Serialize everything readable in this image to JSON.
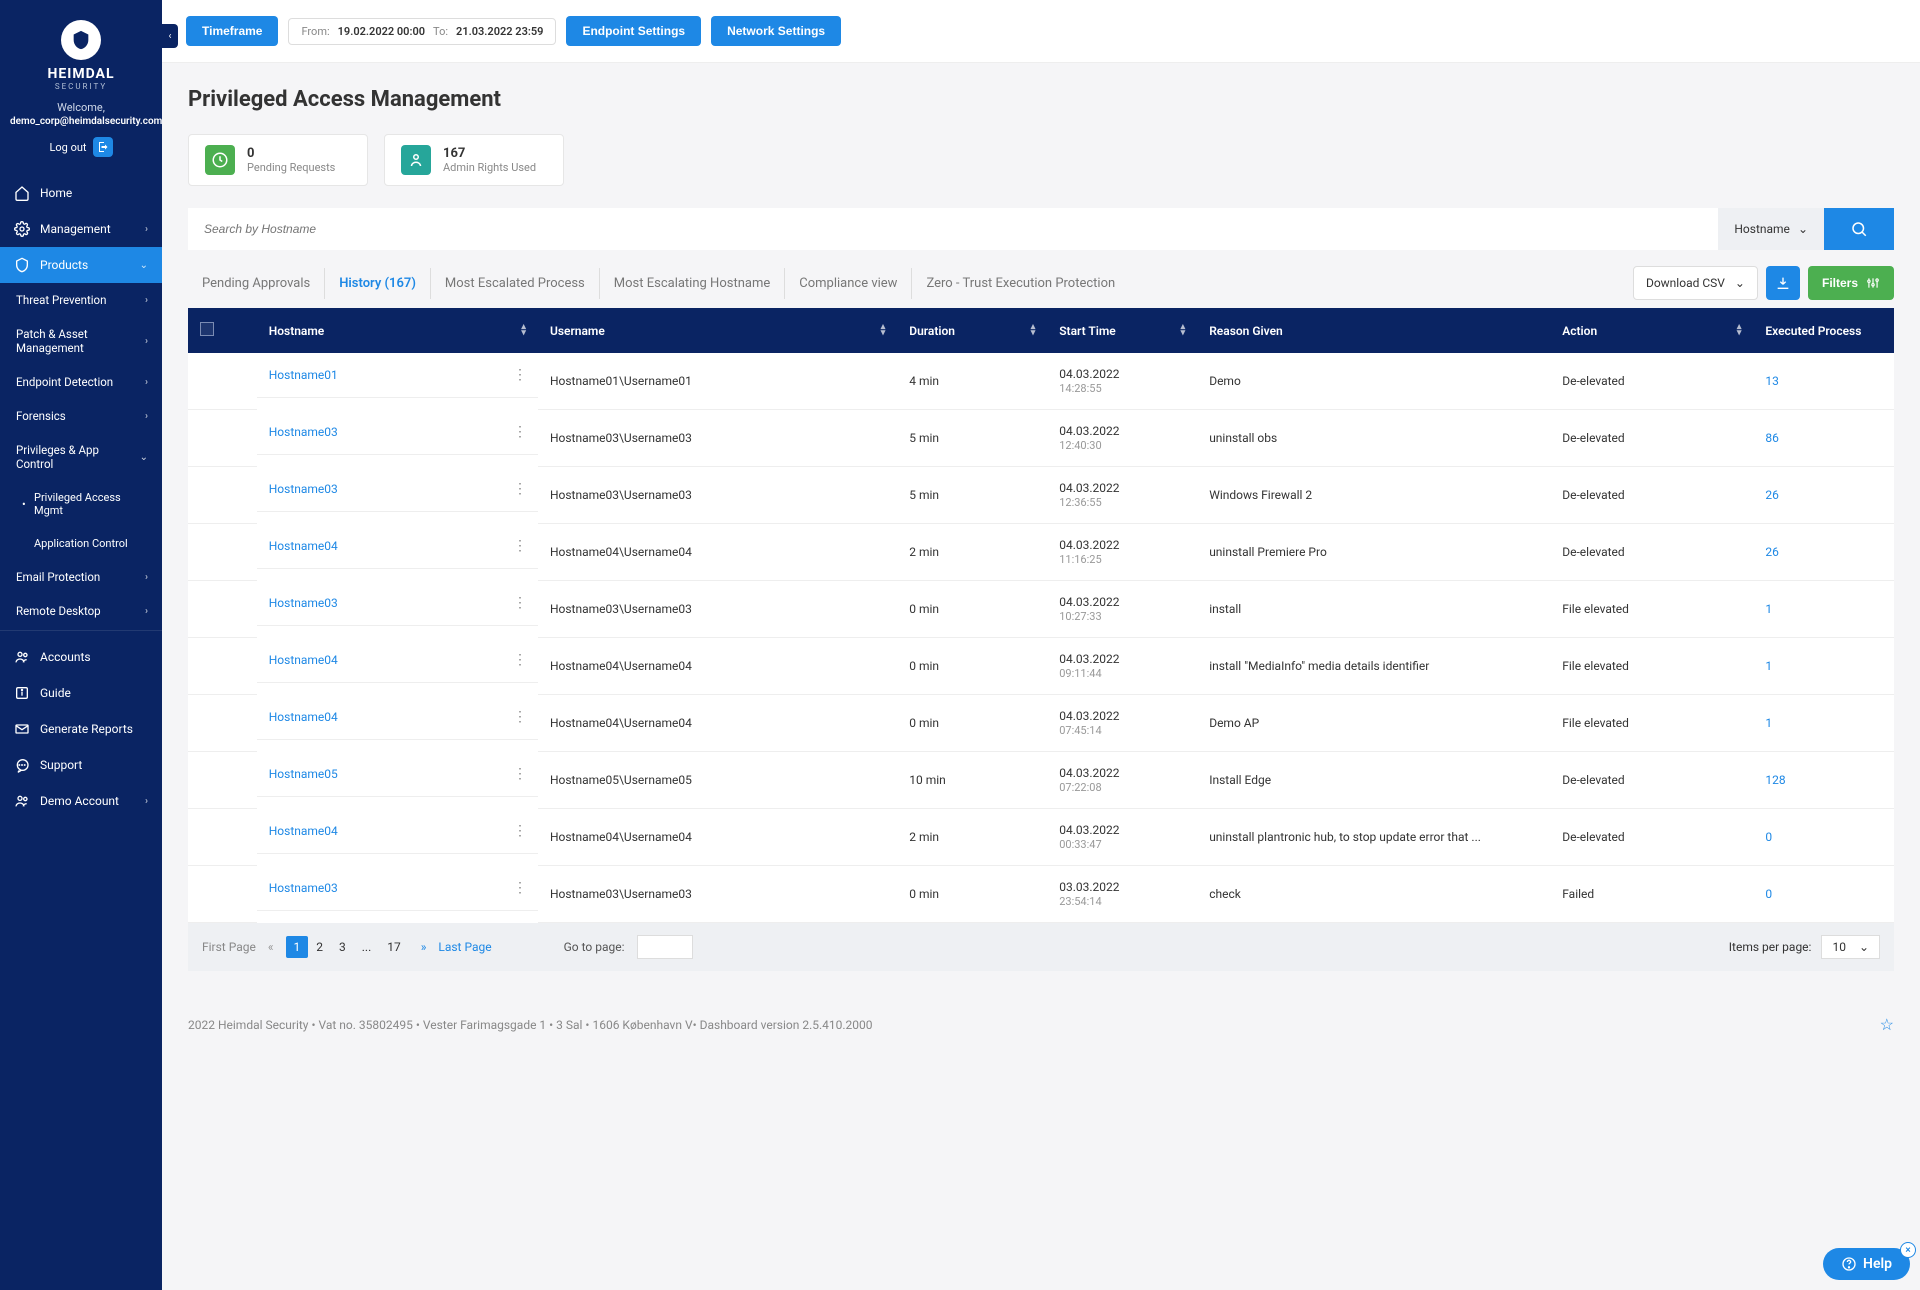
{
  "brand": {
    "name": "HEIMDAL",
    "sub": "SECURITY",
    "welcome": "Welcome,",
    "email": "demo_corp@heimdalsecurity.com",
    "logout": "Log out"
  },
  "sidebar": {
    "main": [
      {
        "label": "Home",
        "icon": "home-icon"
      },
      {
        "label": "Management",
        "icon": "gear-icon",
        "chev": true
      },
      {
        "label": "Products",
        "icon": "shield-icon",
        "chev": true,
        "active": true
      }
    ],
    "products": [
      {
        "label": "Threat Prevention",
        "chev": true
      },
      {
        "label": "Patch & Asset Management",
        "chev": true
      },
      {
        "label": "Endpoint Detection",
        "chev": true
      },
      {
        "label": "Forensics",
        "chev": true
      },
      {
        "label": "Privileges & App Control",
        "chev": true,
        "open": true
      }
    ],
    "pac": [
      {
        "label": "Privileged Access Mgmt",
        "sel": true
      },
      {
        "label": "Application Control"
      }
    ],
    "products2": [
      {
        "label": "Email Protection",
        "chev": true
      },
      {
        "label": "Remote Desktop",
        "chev": true
      }
    ],
    "bottom": [
      {
        "label": "Accounts",
        "icon": "users-icon"
      },
      {
        "label": "Guide",
        "icon": "info-icon"
      },
      {
        "label": "Generate Reports",
        "icon": "mail-icon"
      },
      {
        "label": "Support",
        "icon": "chat-icon"
      },
      {
        "label": "Demo Account",
        "icon": "users-icon",
        "chev": true
      }
    ]
  },
  "topbar": {
    "timeframe": "Timeframe",
    "from_lbl": "From:",
    "from_val": "19.02.2022 00:00",
    "to_lbl": "To:",
    "to_val": "21.03.2022 23:59",
    "endpoint": "Endpoint Settings",
    "network": "Network Settings"
  },
  "page": {
    "title": "Privileged Access Management",
    "cards": [
      {
        "num": "0",
        "lbl": "Pending Requests",
        "icon": "clock-icon",
        "cls": "green"
      },
      {
        "num": "167",
        "lbl": "Admin Rights Used",
        "icon": "badge-icon",
        "cls": "teal"
      }
    ],
    "search_placeholder": "Search by Hostname",
    "search_sel": "Hostname",
    "tabs": [
      "Pending Approvals",
      "History (167)",
      "Most Escalated Process",
      "Most Escalating Hostname",
      "Compliance view",
      "Zero - Trust Execution Protection"
    ],
    "active_tab": 1,
    "download": "Download CSV",
    "filters": "Filters"
  },
  "table": {
    "cols": [
      "",
      "Hostname",
      "Username",
      "Duration",
      "Start Time",
      "Reason Given",
      "Action",
      "Executed Process"
    ],
    "rows": [
      {
        "host": "Hostname01",
        "user": "Hostname01\\Username01",
        "dur": "4 min",
        "date": "04.03.2022",
        "time": "14:28:55",
        "reason": "Demo",
        "action": "De-elevated",
        "exec": "13"
      },
      {
        "host": "Hostname03",
        "user": "Hostname03\\Username03",
        "dur": "5 min",
        "date": "04.03.2022",
        "time": "12:40:30",
        "reason": "uninstall obs",
        "action": "De-elevated",
        "exec": "86"
      },
      {
        "host": "Hostname03",
        "user": "Hostname03\\Username03",
        "dur": "5 min",
        "date": "04.03.2022",
        "time": "12:36:55",
        "reason": "Windows Firewall 2",
        "action": "De-elevated",
        "exec": "26"
      },
      {
        "host": "Hostname04",
        "user": "Hostname04\\Username04",
        "dur": "2 min",
        "date": "04.03.2022",
        "time": "11:16:25",
        "reason": "uninstall Premiere Pro",
        "action": "De-elevated",
        "exec": "26"
      },
      {
        "host": "Hostname03",
        "user": "Hostname03\\Username03",
        "dur": "0 min",
        "date": "04.03.2022",
        "time": "10:27:33",
        "reason": "install",
        "action": "File elevated",
        "exec": "1"
      },
      {
        "host": "Hostname04",
        "user": "Hostname04\\Username04",
        "dur": "0 min",
        "date": "04.03.2022",
        "time": "09:11:44",
        "reason": "install \"MediaInfo\" media details identifier",
        "action": "File elevated",
        "exec": "1"
      },
      {
        "host": "Hostname04",
        "user": "Hostname04\\Username04",
        "dur": "0 min",
        "date": "04.03.2022",
        "time": "07:45:14",
        "reason": "Demo AP",
        "action": "File elevated",
        "exec": "1"
      },
      {
        "host": "Hostname05",
        "user": "Hostname05\\Username05",
        "dur": "10 min",
        "date": "04.03.2022",
        "time": "07:22:08",
        "reason": "Install Edge",
        "action": "De-elevated",
        "exec": "128"
      },
      {
        "host": "Hostname04",
        "user": "Hostname04\\Username04",
        "dur": "2 min",
        "date": "04.03.2022",
        "time": "00:33:47",
        "reason": "uninstall plantronic hub, to stop update error that ...",
        "action": "De-elevated",
        "exec": "0"
      },
      {
        "host": "Hostname03",
        "user": "Hostname03\\Username03",
        "dur": "0 min",
        "date": "03.03.2022",
        "time": "23:54:14",
        "reason": "check",
        "action": "Failed",
        "exec": "0"
      }
    ]
  },
  "pager": {
    "first": "First Page",
    "pages": [
      "1",
      "2",
      "3",
      "...",
      "17"
    ],
    "active": 0,
    "last": "Last Page",
    "goto": "Go to page:",
    "ipp_lbl": "Items per page:",
    "ipp_val": "10"
  },
  "footer": "2022 Heimdal Security • Vat no. 35802495 • Vester Farimagsgade 1 • 3 Sal • 1606 København V• Dashboard version 2.5.410.2000",
  "help": "Help"
}
